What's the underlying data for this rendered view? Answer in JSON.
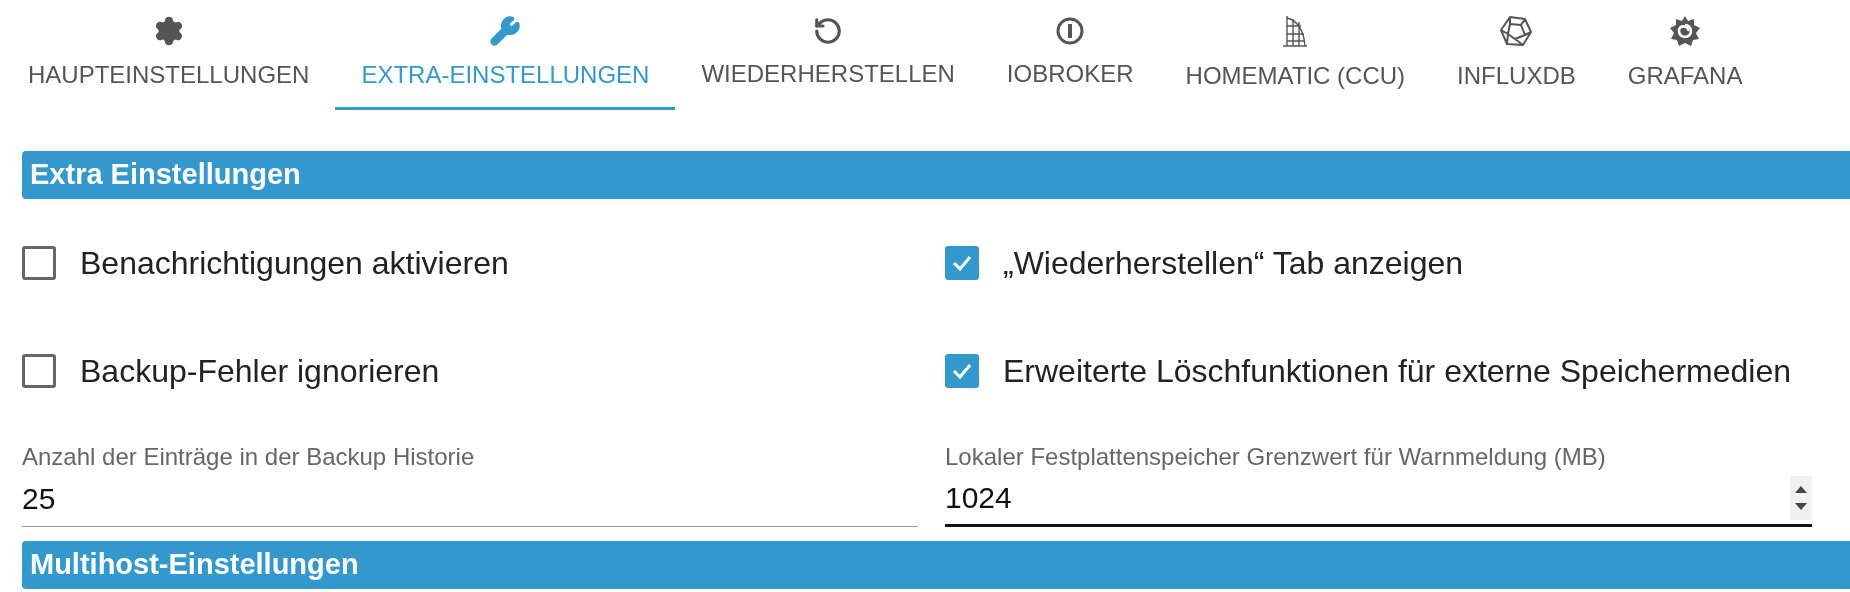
{
  "tabs": [
    {
      "label": "HAUPTEINSTELLUNGEN",
      "kind": "gear",
      "selected": false
    },
    {
      "label": "EXTRA-EINSTELLUNGEN",
      "kind": "wrench",
      "selected": true
    },
    {
      "label": "WIEDERHERSTELLEN",
      "kind": "restore",
      "selected": false
    },
    {
      "label": "IOBROKER",
      "kind": "iobroker",
      "selected": false
    },
    {
      "label": "HOMEMATIC (CCU)",
      "kind": "building",
      "selected": false
    },
    {
      "label": "INFLUXDB",
      "kind": "polyhedron",
      "selected": false
    },
    {
      "label": "GRAFANA",
      "kind": "swirl",
      "selected": false
    }
  ],
  "sections": [
    {
      "title": "Extra Einstellungen",
      "checkboxes": [
        {
          "label": "Benachrichtigungen aktivieren",
          "checked": false
        },
        {
          "label": "„Wiederherstellen“ Tab anzeigen",
          "checked": true
        },
        {
          "label": "Backup-Fehler ignorieren",
          "checked": false
        },
        {
          "label": "Erweiterte Löschfunktionen für externe Speichermedien",
          "checked": true
        }
      ],
      "fields": [
        {
          "label": "Anzahl der Einträge in der Backup Historie",
          "value": "25",
          "focused": false
        },
        {
          "label": "Lokaler Festplattenspeicher Grenzwert für Warnmeldung (MB)",
          "value": "1024",
          "focused": true
        }
      ]
    },
    {
      "title": "Multihost-Einstellungen"
    }
  ]
}
